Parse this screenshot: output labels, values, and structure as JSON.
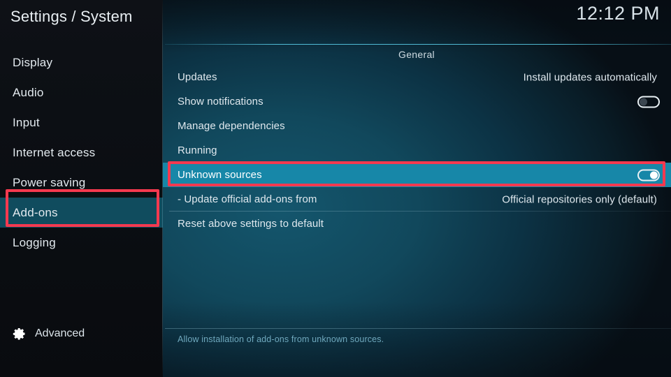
{
  "header": {
    "title": "Settings / System",
    "clock": "12:12 PM"
  },
  "sidebar": {
    "items": [
      {
        "label": "Display",
        "selected": false
      },
      {
        "label": "Audio",
        "selected": false
      },
      {
        "label": "Input",
        "selected": false
      },
      {
        "label": "Internet access",
        "selected": false
      },
      {
        "label": "Power saving",
        "selected": false
      },
      {
        "label": "Add-ons",
        "selected": true
      },
      {
        "label": "Logging",
        "selected": false
      }
    ],
    "footer": {
      "icon": "gear-icon",
      "label": "Advanced"
    }
  },
  "main": {
    "group_title": "General",
    "rows": [
      {
        "label": "Updates",
        "value": "Install updates automatically",
        "control": "none",
        "highlight": false,
        "separator": false
      },
      {
        "label": "Show notifications",
        "value": "",
        "control": "toggle",
        "toggle_state": "off",
        "highlight": false,
        "separator": false
      },
      {
        "label": "Manage dependencies",
        "value": "",
        "control": "none",
        "highlight": false,
        "separator": false
      },
      {
        "label": "Running",
        "value": "",
        "control": "none",
        "highlight": false,
        "separator": false
      },
      {
        "label": "Unknown sources",
        "value": "",
        "control": "toggle",
        "toggle_state": "on",
        "highlight": true,
        "separator": false
      },
      {
        "label": "- Update official add-ons from",
        "value": "Official repositories only (default)",
        "control": "none",
        "highlight": false,
        "separator": true
      },
      {
        "label": "Reset above settings to default",
        "value": "",
        "control": "none",
        "highlight": false,
        "separator": false
      }
    ],
    "help_text": "Allow installation of add-ons from unknown sources."
  },
  "annotations": [
    {
      "name": "annotation-box-addons",
      "color": "#f4394f"
    },
    {
      "name": "annotation-box-unknown-sources",
      "color": "#f4394f"
    }
  ]
}
